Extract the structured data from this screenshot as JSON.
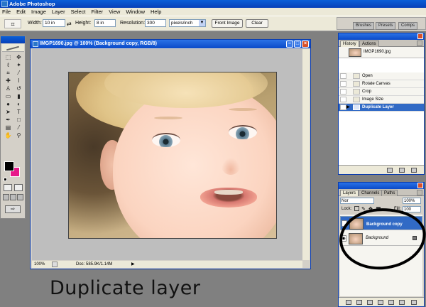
{
  "app": {
    "title": "Adobe Photoshop"
  },
  "menu": [
    "File",
    "Edit",
    "Image",
    "Layer",
    "Select",
    "Filter",
    "View",
    "Window",
    "Help"
  ],
  "options": {
    "width_label": "Width:",
    "width_value": "10 in",
    "height_label": "Height:",
    "height_value": "8 in",
    "resolution_label": "Resolution:",
    "resolution_value": "300",
    "units_value": "pixels/inch",
    "front_image": "Front Image",
    "clear": "Clear"
  },
  "well_tabs": [
    "Brushes",
    "Presets",
    "Comps"
  ],
  "document": {
    "title": "IMGP1690.jpg @ 100% (Background copy, RGB/8)",
    "zoom": "100%",
    "status": "Doc: 585.9K/1.14M"
  },
  "history": {
    "tabs": [
      "History",
      "Actions"
    ],
    "snapshot": "IMGP1690.jpg",
    "steps": [
      "Open",
      "Rotate Canvas",
      "Crop",
      "Image Size",
      "Duplicate Layer"
    ],
    "active_step": "Duplicate Layer"
  },
  "layers": {
    "tabs": [
      "Layers",
      "Channels",
      "Paths"
    ],
    "blend_mode": "Nor",
    "opacity_value": "100%",
    "lock_label": "Lock:",
    "fill_label": "Fill:",
    "fill_value": "100",
    "items": [
      {
        "name": "Background copy",
        "selected": true
      },
      {
        "name": "Background",
        "selected": false
      }
    ]
  },
  "colors": {
    "foreground": "#000000",
    "background": "#e8198b",
    "accent": "#316ac5"
  },
  "caption": "Duplicate layer"
}
